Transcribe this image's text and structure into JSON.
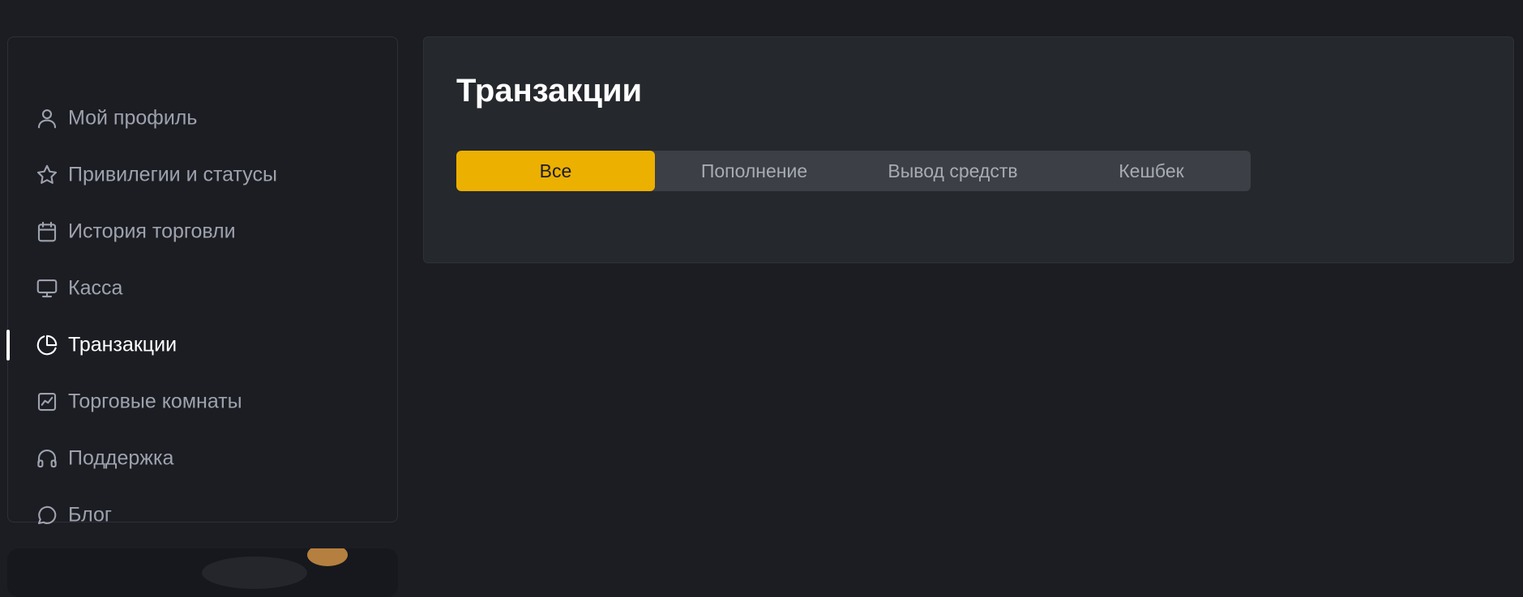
{
  "sidebar": {
    "items": [
      {
        "label": "Мой профиль",
        "icon": "user-icon"
      },
      {
        "label": "Привилегии и статусы",
        "icon": "star-icon"
      },
      {
        "label": "История торговли",
        "icon": "calendar-icon"
      },
      {
        "label": "Касса",
        "icon": "monitor-icon"
      },
      {
        "label": "Транзакции",
        "icon": "pie-chart-icon",
        "active": true
      },
      {
        "label": "Торговые комнаты",
        "icon": "trending-chart-icon"
      },
      {
        "label": "Поддержка",
        "icon": "headphones-icon"
      },
      {
        "label": "Блог",
        "icon": "chat-bubble-icon"
      }
    ]
  },
  "main": {
    "title": "Транзакции",
    "tabs": [
      {
        "label": "Все",
        "active": true
      },
      {
        "label": "Пополнение"
      },
      {
        "label": "Вывод средств"
      },
      {
        "label": "Кешбек"
      }
    ]
  },
  "colors": {
    "background": "#1b1d23",
    "card": "#25282c",
    "accent": "#ecb000",
    "text_muted": "#9ea2ad",
    "text_active": "#ffffff"
  }
}
